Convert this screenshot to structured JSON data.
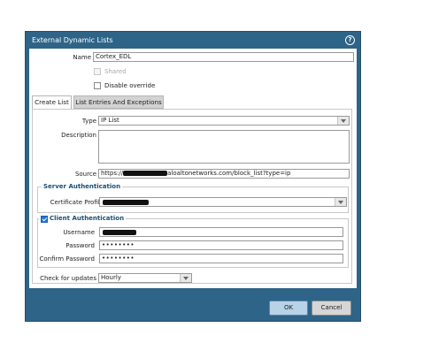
{
  "dialog": {
    "title": "External Dynamic Lists",
    "help_icon": "help-icon"
  },
  "form": {
    "name_label": "Name",
    "name_value": "Cortex_EDL",
    "shared_label": "Shared",
    "shared_checked": false,
    "disable_override_label": "Disable override",
    "disable_override_checked": false
  },
  "tabs": [
    {
      "label": "Create List",
      "active": true
    },
    {
      "label": "List Entries And Exceptions",
      "active": false
    }
  ],
  "create_list": {
    "type_label": "Type",
    "type_value": "IP List",
    "description_label": "Description",
    "description_value": "",
    "source_label": "Source",
    "source_prefix": "https://",
    "source_suffix": "aloaltonetworks.com/block_list?type=ip"
  },
  "server_auth": {
    "title": "Server Authentication",
    "cert_profile_label": "Certificate Profile"
  },
  "client_auth": {
    "title": "Client Authentication",
    "enabled": true,
    "username_label": "Username",
    "password_label": "Password",
    "password_value": "••••••••",
    "confirm_password_label": "Confirm Password",
    "confirm_password_value": "••••••••"
  },
  "updates": {
    "label": "Check for updates",
    "value": "Hourly"
  },
  "buttons": {
    "ok": "OK",
    "cancel": "Cancel"
  },
  "colors": {
    "dialog_frame": "#2e6487",
    "ok_button": "#b8d2e8",
    "group_title": "#1a4e73",
    "checkbox_checked": "#1e77d3"
  }
}
